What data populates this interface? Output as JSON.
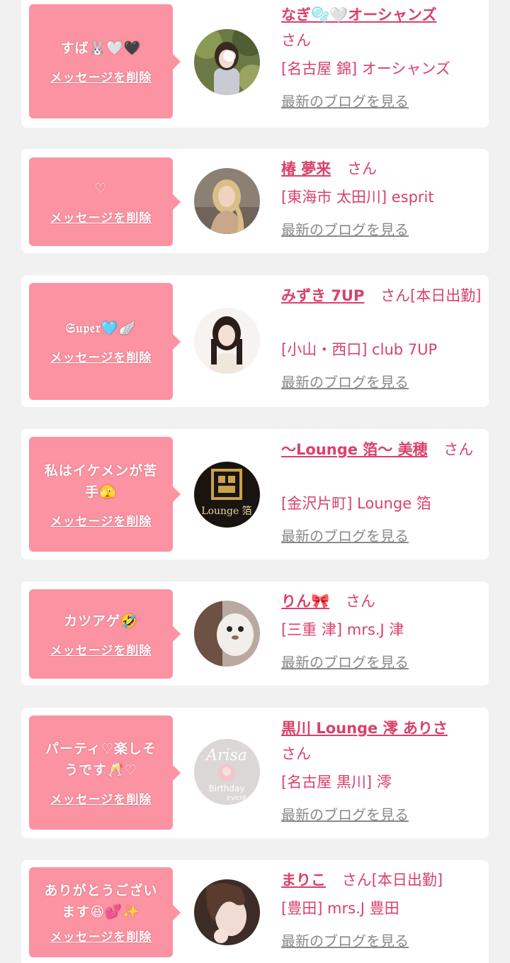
{
  "cards": [
    {
      "message_lines": [
        "すば🐰🤍🖤"
      ],
      "delete_label": "メッセージを削除",
      "name": "なぎ🫧🤍オーシャンズ",
      "suffix": "さん",
      "location": "[名古屋 錦] オーシャンズ",
      "blog_label": "最新のブログを見る",
      "avatar": "photo-woman-in-park"
    },
    {
      "message_lines": [
        "♡"
      ],
      "delete_label": "メッセージを削除",
      "name": "椿 夢来",
      "suffix": "さん",
      "location": "[東海市 太田川] esprit",
      "blog_label": "最新のブログを見る",
      "avatar": "photo-blonde-woman"
    },
    {
      "message_lines": [
        "𝔖𝔲𝔭𝔢𝔯🩵🪽"
      ],
      "delete_label": "メッセージを削除",
      "name": "みずき 7UP",
      "suffix": "さん[本日出勤]",
      "location": "[小山・西口] club 7UP",
      "blog_label": "最新のブログを見る",
      "avatar": "photo-dark-haired-woman"
    },
    {
      "message_lines": [
        "私はイケメンが苦",
        "手🫣"
      ],
      "delete_label": "メッセージを削除",
      "name": "〜Lounge 箔〜 美穂",
      "suffix": "さん",
      "location": "[金沢片町] Lounge 箔",
      "blog_label": "最新のブログを見る",
      "avatar": "logo-lounge"
    },
    {
      "message_lines": [
        "カツアゲ🤣"
      ],
      "delete_label": "メッセージを削除",
      "name": "りん🎀",
      "suffix": "さん",
      "location": "[三重 津] mrs.J 津",
      "blog_label": "最新のブログを見る",
      "avatar": "photo-plush"
    },
    {
      "message_lines": [
        "パーティ♡楽しそ",
        "うです🥂♡"
      ],
      "delete_label": "メッセージを削除",
      "name": "黒川 Lounge 澪 ありさ",
      "suffix": "さん",
      "location": "[名古屋 黒川] 澪",
      "blog_label": "最新のブログを見る",
      "avatar": "photo-birthday-event"
    },
    {
      "message_lines": [
        "ありがとうござい",
        "ます😆💕✨"
      ],
      "delete_label": "メッセージを削除",
      "name": "まりこ",
      "suffix": "さん[本日出勤]",
      "location": "[豊田] mrs.J 豊田",
      "blog_label": "最新のブログを見る",
      "avatar": "photo-woman-portrait"
    }
  ],
  "avatar4_text": "Lounge 箔",
  "avatar6_text_1": "Arisa",
  "avatar6_text_2": "Birthday",
  "avatar6_text_3": "event",
  "colors": {
    "page_background": "#f1f1f1",
    "card_background": "#ffffff",
    "bubble_pink": "#fc93a2",
    "accent_text": "#d9416b",
    "blog_link_gray": "#8a8a8a"
  }
}
